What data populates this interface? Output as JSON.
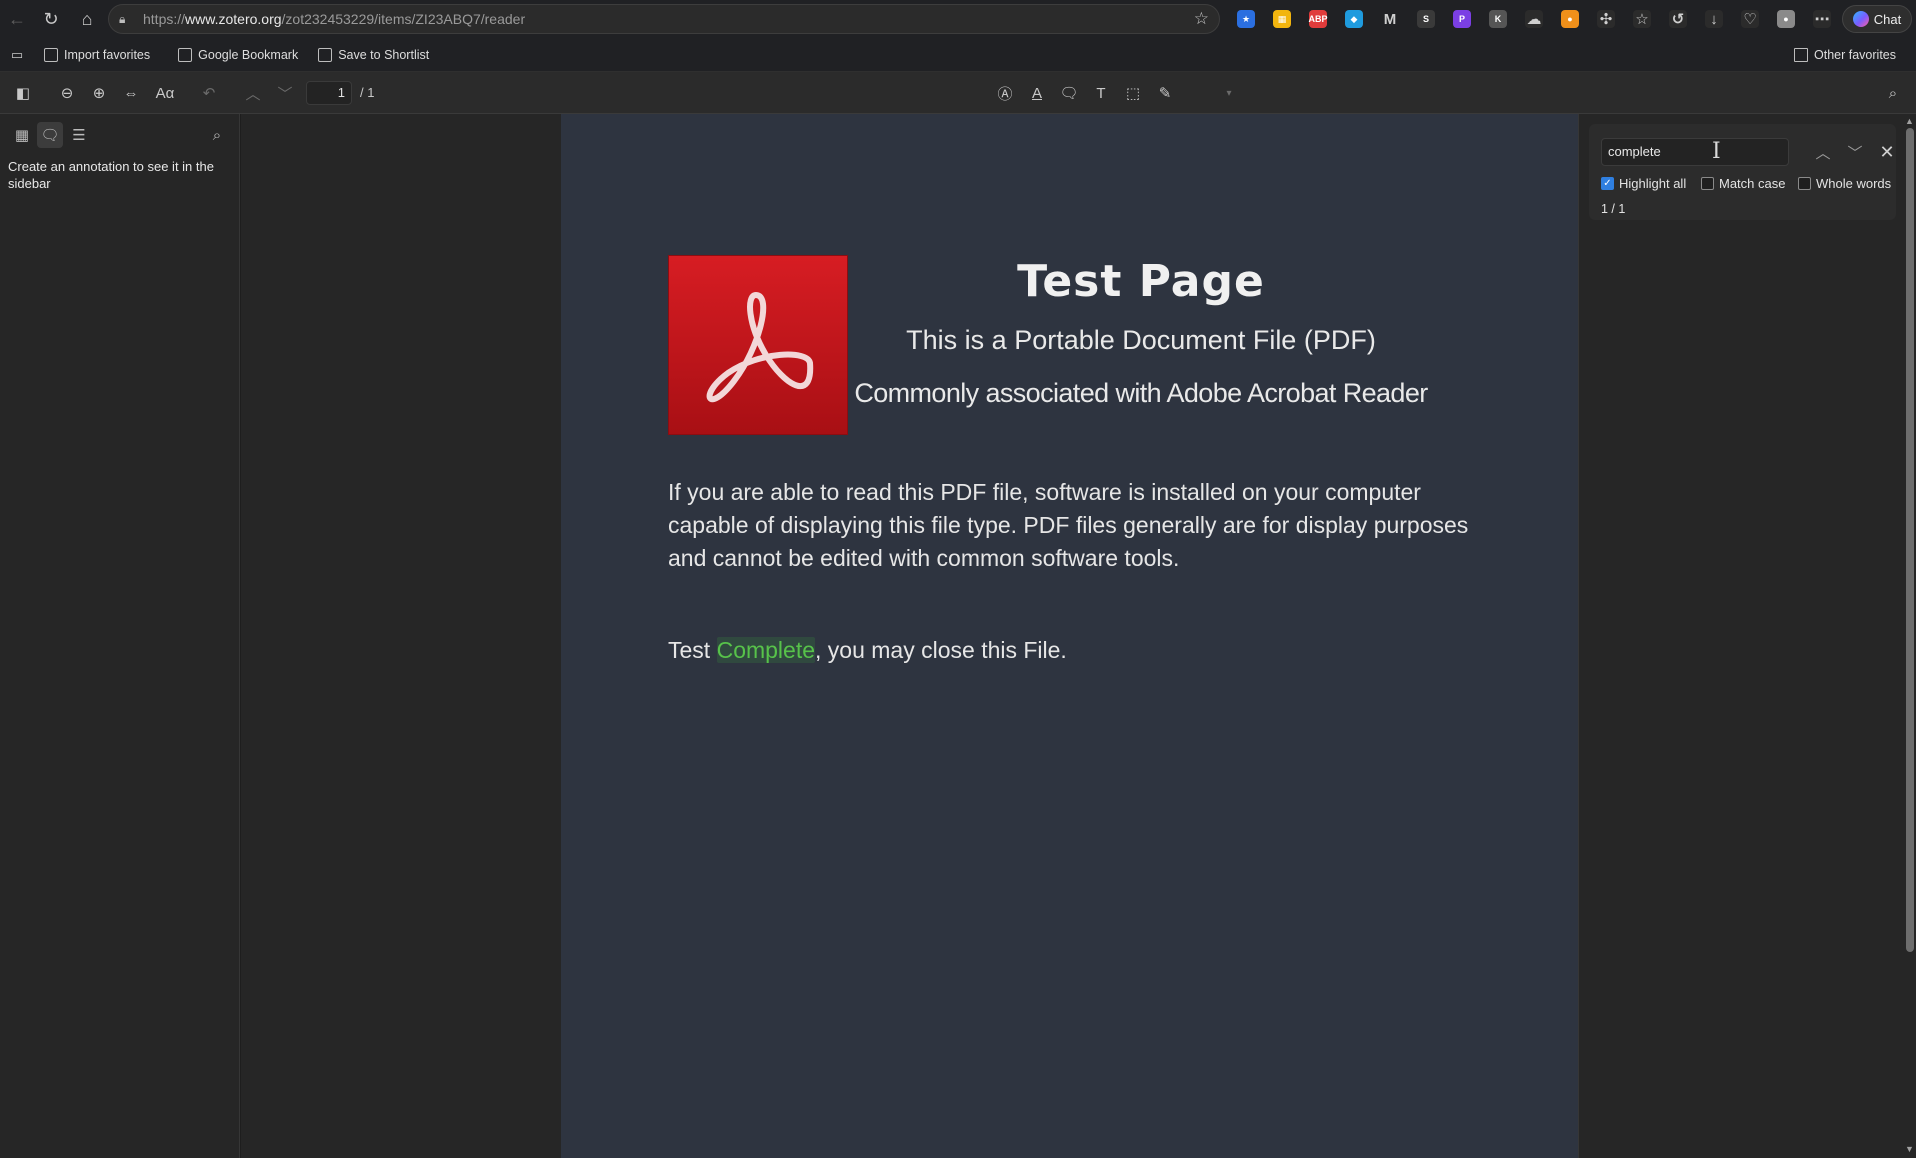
{
  "browser": {
    "url_prefix": "https://",
    "url_host": "www.zotero.org",
    "url_path": "/zot232453229/items/ZI23ABQ7/reader",
    "chat_label": "Chat",
    "extensions": [
      {
        "name": "bookmark-ext-icon",
        "color": "#2b6fe0",
        "glyph": "★"
      },
      {
        "name": "folder-ext-icon",
        "color": "#f2b50f",
        "glyph": "▦"
      },
      {
        "name": "adblock-ext-icon",
        "color": "#e03b3b",
        "glyph": "ABP"
      },
      {
        "name": "gem-ext-icon",
        "color": "#1f9bde",
        "glyph": "◆"
      },
      {
        "name": "malwarebytes-ext-icon",
        "color": "#202124",
        "glyph": "M"
      },
      {
        "name": "s-ext-icon",
        "color": "#3a3a3a",
        "glyph": "S"
      },
      {
        "name": "p-ext-icon",
        "color": "#7b3fe4",
        "glyph": "P"
      },
      {
        "name": "k-ext-icon",
        "color": "#555555",
        "glyph": "K"
      },
      {
        "name": "cloud-ext-icon",
        "color": "#2b2b2b",
        "glyph": "☁"
      },
      {
        "name": "orange-ext-icon",
        "color": "#f0901a",
        "glyph": "●"
      },
      {
        "name": "puzzle-ext-icon",
        "color": "#2b2b2b",
        "glyph": "✣"
      },
      {
        "name": "favorites-icon",
        "color": "#2b2b2b",
        "glyph": "☆"
      },
      {
        "name": "history-icon",
        "color": "#2b2b2b",
        "glyph": "↺"
      },
      {
        "name": "download-icon",
        "color": "#2b2b2b",
        "glyph": "↓"
      },
      {
        "name": "health-icon",
        "color": "#2b2b2b",
        "glyph": "♡"
      },
      {
        "name": "profile-icon",
        "color": "#8a8a8a",
        "glyph": "●"
      },
      {
        "name": "more-icon",
        "color": "#2b2b2b",
        "glyph": "⋯"
      }
    ]
  },
  "favorites": {
    "items": [
      "Import favorites",
      "Google Bookmark",
      "Save to Shortlist"
    ],
    "other": "Other favorites"
  },
  "toolbar": {
    "page_current": "1",
    "page_total": "/ 1"
  },
  "sidebar": {
    "hint": "Create an annotation to see it in the sidebar"
  },
  "document": {
    "title": "Test Page",
    "subtitle_1": "This is a Portable Document File (PDF)",
    "subtitle_2": "Commonly associated with Adobe Acrobat Reader",
    "body": "If you are able to read this PDF file, software is installed on your computer capable of displaying this file type. PDF files generally are for display purposes and cannot be edited with common software tools.",
    "final_before": "Test ",
    "final_highlight": "Complete",
    "final_after": ", you may close this File."
  },
  "find": {
    "query": "complete",
    "highlight_all_label": "Highlight all",
    "highlight_all_checked": true,
    "match_case_label": "Match case",
    "match_case_checked": false,
    "whole_words_label": "Whole words",
    "whole_words_checked": false,
    "result_count": "1 / 1"
  },
  "colors": {
    "accent": "#2f7fe0",
    "highlight_text": "#57c24a",
    "pdf_logo_red": "#d71d23"
  }
}
